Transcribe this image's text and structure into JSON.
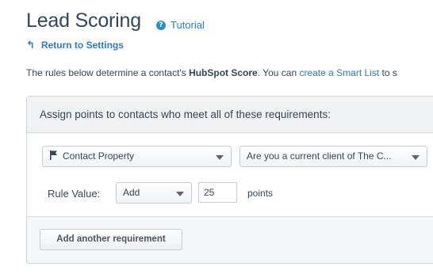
{
  "header": {
    "title": "Lead Scoring",
    "tutorial_label": "Tutorial",
    "return_label": "Return to Settings"
  },
  "description": {
    "prefix": "The rules below determine a contact's ",
    "bold": "HubSpot Score",
    "middle": ". You can ",
    "link": "create a Smart List",
    "suffix": " to s"
  },
  "panel": {
    "header": "Assign points to contacts who meet all of these requirements:",
    "property_select": "Contact Property",
    "question_select": "Are you a current client of The C...",
    "rule_value_label": "Rule Value:",
    "operator_select": "Add",
    "points_value": "25",
    "points_label": "points",
    "add_button": "Add another requirement"
  },
  "colors": {
    "link": "#2e7bc4",
    "text": "#33475b",
    "panel_bg": "#f6f7f8"
  },
  "icons": {
    "help": "help-circle-icon",
    "return": "return-arrow-icon",
    "flag": "flag-icon",
    "caret": "chevron-down-icon"
  }
}
